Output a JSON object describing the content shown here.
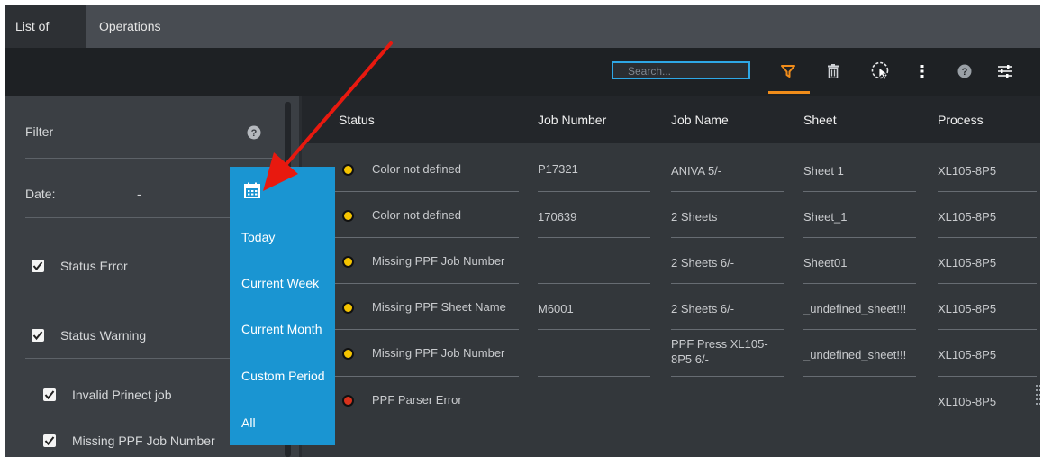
{
  "tabs": [
    {
      "label": "List of PPF",
      "active": true
    },
    {
      "label": "Operations",
      "active": false
    }
  ],
  "toolbar": {
    "search_placeholder": "Search...",
    "icons": [
      "filter-icon",
      "trash-icon",
      "select-cursor-icon",
      "more-vertical-icon",
      "help-icon",
      "settings-sliders-icon"
    ],
    "active_icon": "filter-icon",
    "accent_color": "#f08c1a"
  },
  "filter_panel": {
    "title": "Filter",
    "date_label": "Date:",
    "date_value": "-",
    "checkboxes": [
      {
        "label": "Status Error",
        "checked": true
      },
      {
        "label": "Status Warning",
        "checked": true
      },
      {
        "label": "Invalid Prinect job",
        "checked": true
      },
      {
        "label": "Missing PPF Job Number",
        "checked": true
      }
    ]
  },
  "date_dropdown": {
    "options": [
      "Today",
      "Current Week",
      "Current Month",
      "Custom Period",
      "All"
    ],
    "color": "#1a95d2"
  },
  "grid": {
    "columns": [
      "Status",
      "Job Number",
      "Job Name",
      "Sheet",
      "Process"
    ],
    "rows": [
      {
        "status": "Color not defined",
        "status_color": "#f5c400",
        "job_number": "P17321",
        "job_name": "ANIVA 5/-",
        "sheet": "Sheet 1",
        "process": "XL105-8P5"
      },
      {
        "status": "Color not defined",
        "status_color": "#f5c400",
        "job_number": "170639",
        "job_name": "2 Sheets",
        "sheet": "Sheet_1",
        "process": "XL105-8P5"
      },
      {
        "status": "Missing PPF Job Number",
        "status_color": "#f5c400",
        "job_number": "",
        "job_name": "2 Sheets 6/-",
        "sheet": "Sheet01",
        "process": "XL105-8P5"
      },
      {
        "status": "Missing PPF Sheet Name",
        "status_color": "#f5c400",
        "job_number": "M6001",
        "job_name": "2 Sheets 6/-",
        "sheet": "_undefined_sheet!!!",
        "process": "XL105-8P5"
      },
      {
        "status": "Missing PPF Job Number",
        "status_color": "#f5c400",
        "job_number": "",
        "job_name": "PPF Press XL105-8P5 6/-",
        "sheet": "_undefined_sheet!!!",
        "process": "XL105-8P5"
      },
      {
        "status": "PPF Parser Error",
        "status_color": "#d9321c",
        "job_number": "",
        "job_name": "",
        "sheet": "",
        "process": "XL105-8P5"
      }
    ]
  },
  "annotation": {
    "arrow_color": "#e8190f"
  }
}
